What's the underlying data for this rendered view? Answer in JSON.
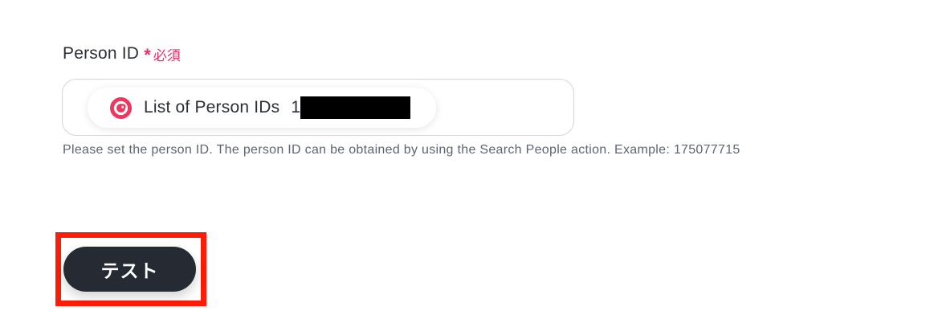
{
  "field": {
    "label": "Person ID",
    "required_mark": "*",
    "required_text": "必須",
    "chip": {
      "icon": "app-logo-icon",
      "label": "List of Person IDs",
      "value_prefix": "1",
      "value_redacted": true
    },
    "help_text": "Please set the person ID. The person ID can be obtained by using the Search People action. Example: 175077715"
  },
  "actions": {
    "test_label": "テスト"
  },
  "colors": {
    "required": "#e5336a",
    "button_bg": "#262a33",
    "highlight": "#fb1d07",
    "icon": "#f1355f"
  }
}
